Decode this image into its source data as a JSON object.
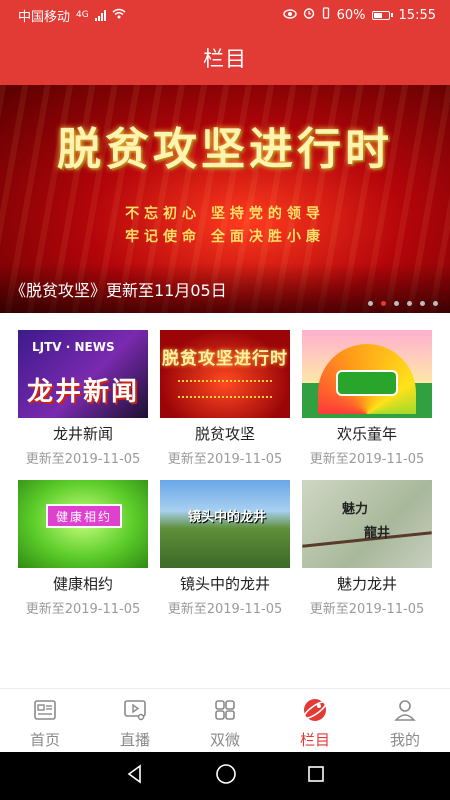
{
  "status": {
    "carrier": "中国移动",
    "network": "4G",
    "battery": "60%",
    "time": "15:55"
  },
  "header": {
    "title": "栏目"
  },
  "banner": {
    "headline": "脱贫攻坚进行时",
    "slogan_line1": "不忘初心  坚持党的领导",
    "slogan_line2": "牢记使命  全面决胜小康",
    "caption": "《脱贫攻坚》更新至11月05日",
    "dots_total": 6,
    "active_dot": 1
  },
  "programs": [
    {
      "name": "龙井新闻",
      "update": "更新至2019-11-05",
      "thumb_text_small": "LJTV · NEWS",
      "thumb_text": "龙井新闻"
    },
    {
      "name": "脱贫攻坚",
      "update": "更新至2019-11-05",
      "thumb_text": "脱贫攻坚进行时"
    },
    {
      "name": "欢乐童年",
      "update": "更新至2019-11-05",
      "thumb_text": ""
    },
    {
      "name": "健康相约",
      "update": "更新至2019-11-05",
      "thumb_text": "健康相约"
    },
    {
      "name": "镜头中的龙井",
      "update": "更新至2019-11-05",
      "thumb_text": "镜头中的龙井"
    },
    {
      "name": "魅力龙井",
      "update": "更新至2019-11-05",
      "thumb_text": "魅力",
      "thumb_text2": "龍井"
    }
  ],
  "bottom_nav": [
    {
      "label": "首页",
      "icon": "news-icon",
      "active": false
    },
    {
      "label": "直播",
      "icon": "live-play-icon",
      "active": false
    },
    {
      "label": "双微",
      "icon": "grid-icon",
      "active": false
    },
    {
      "label": "栏目",
      "icon": "planet-icon",
      "active": true
    },
    {
      "label": "我的",
      "icon": "user-icon",
      "active": false
    }
  ],
  "colors": {
    "accent": "#e23b36",
    "muted": "#9a9a9a"
  }
}
